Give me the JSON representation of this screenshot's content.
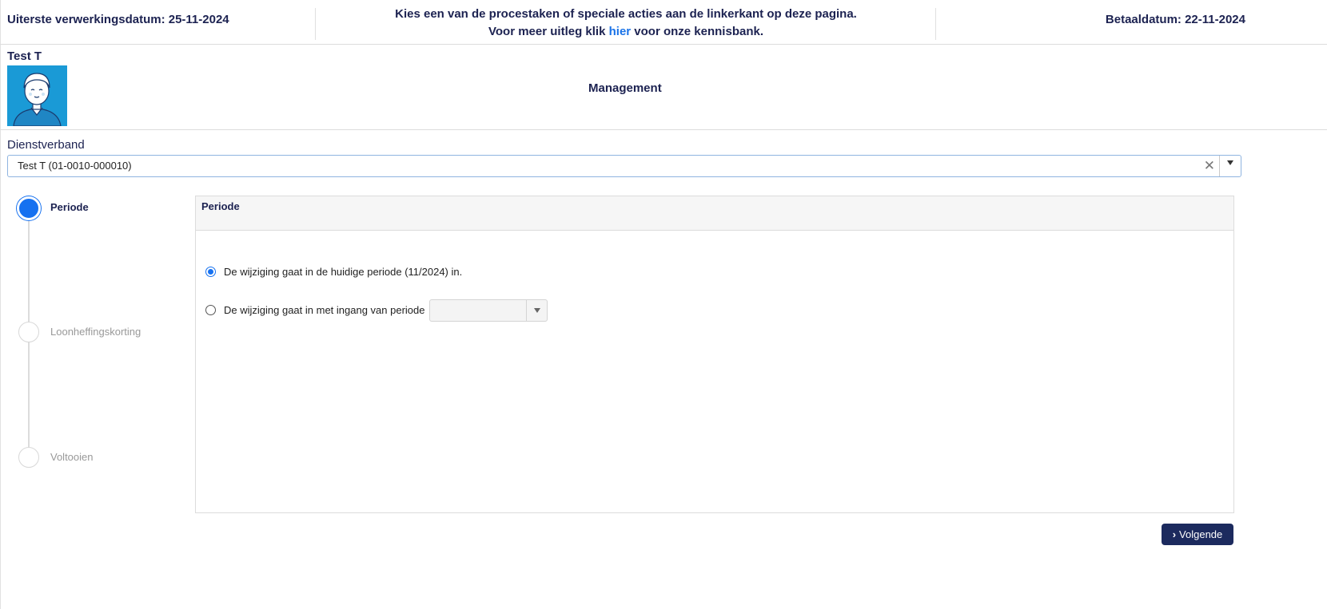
{
  "topbar": {
    "processing_date": "Uiterste verwerkingsdatum: 25-11-2024",
    "info_line1": "Kies een van de procestaken of speciale acties aan de linkerkant op deze pagina.",
    "info_line2_prefix": "Voor meer uitleg klik ",
    "info_link": "hier",
    "info_line2_suffix": " voor onze kennisbank.",
    "payment_date": "Betaaldatum: 22-11-2024"
  },
  "employee": {
    "name": "Test T",
    "department": "Management"
  },
  "employment": {
    "label": "Dienstverband",
    "selected": "Test T (01-0010-000010)",
    "clear_glyph": "✕"
  },
  "stepper": {
    "steps": [
      {
        "label": "Periode",
        "active": true
      },
      {
        "label": "Loonheffingskorting",
        "active": false
      },
      {
        "label": "Voltooien",
        "active": false
      }
    ]
  },
  "panel": {
    "title": "Periode",
    "options": [
      {
        "label": "De wijziging gaat in de huidige periode (11/2024) in.",
        "checked": true
      },
      {
        "label": "De wijziging gaat in met ingang van periode",
        "checked": false
      }
    ],
    "period_select_value": ""
  },
  "actions": {
    "next_label": "Volgende"
  },
  "colors": {
    "primary": "#1671f0",
    "navy": "#1c2a5e",
    "avatar_bg": "#1a9ad6"
  }
}
